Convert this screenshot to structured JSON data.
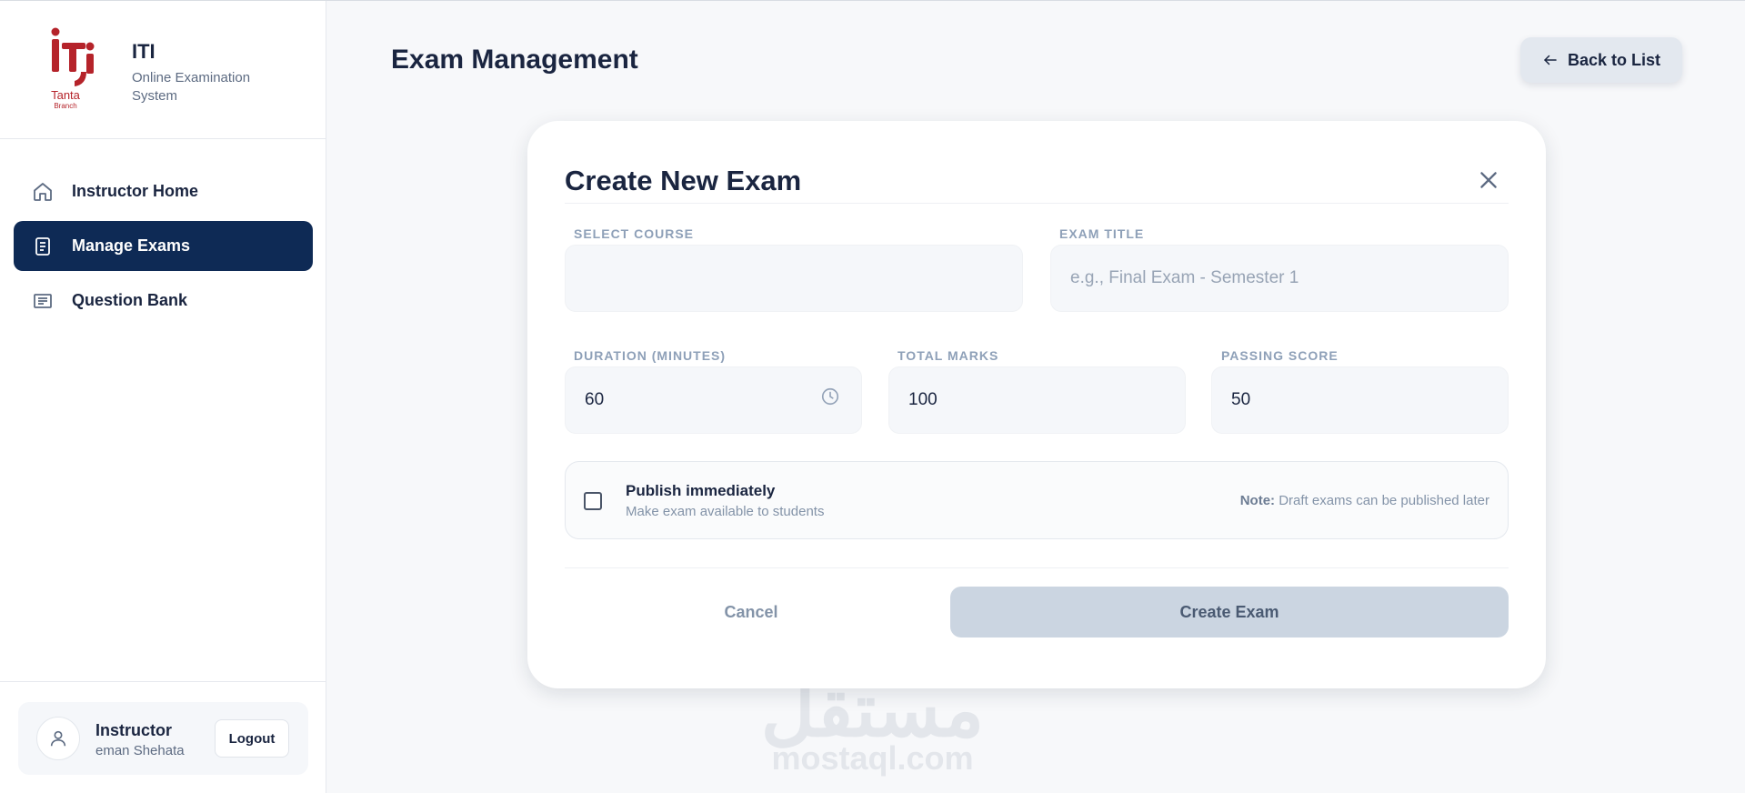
{
  "brand": {
    "logo_text": "iti",
    "logo_sub": "Tanta",
    "logo_sub2": "Branch",
    "title": "ITI",
    "subtitle": "Online Examination System"
  },
  "sidebar": {
    "items": [
      {
        "label": "Instructor Home",
        "icon": "home-icon",
        "active": false
      },
      {
        "label": "Manage Exams",
        "icon": "document-icon",
        "active": true
      },
      {
        "label": "Question Bank",
        "icon": "list-icon",
        "active": false
      }
    ]
  },
  "user": {
    "role": "Instructor",
    "name": "eman Shehata",
    "logout_label": "Logout"
  },
  "header": {
    "title": "Exam Management",
    "back_label": "Back to List"
  },
  "modal": {
    "title": "Create New Exam",
    "course": {
      "label": "SELECT COURSE",
      "value": ""
    },
    "exam_title": {
      "label": "EXAM TITLE",
      "value": "",
      "placeholder": "e.g., Final Exam - Semester 1"
    },
    "duration": {
      "label": "DURATION (MINUTES)",
      "value": "60"
    },
    "total_marks": {
      "label": "TOTAL MARKS",
      "value": "100"
    },
    "passing_score": {
      "label": "PASSING SCORE",
      "value": "50"
    },
    "publish": {
      "checked": false,
      "title": "Publish immediately",
      "subtitle": "Make exam available to students",
      "note_label": "Note:",
      "note_text": " Draft exams can be published later"
    },
    "cancel_label": "Cancel",
    "create_label": "Create Exam"
  },
  "watermark": {
    "arabic": "مستقل",
    "latin": "mostaql.com"
  },
  "colors": {
    "primary": "#0e2a55",
    "logo_red": "#b5232a",
    "background": "#f7f8fa"
  }
}
